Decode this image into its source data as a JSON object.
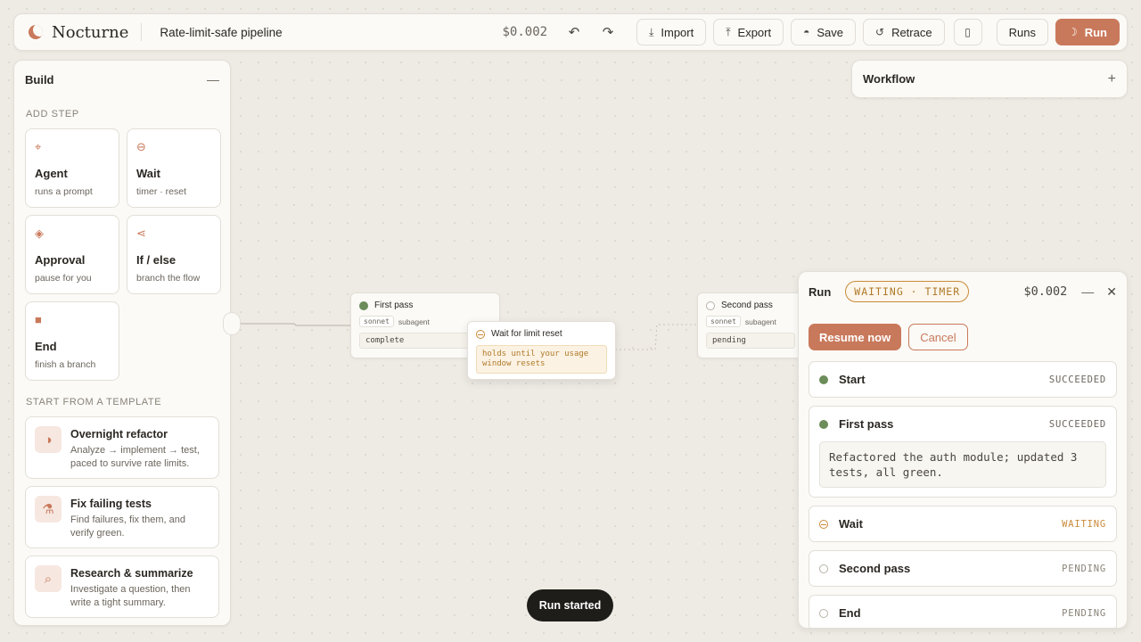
{
  "app": {
    "name": "Nocturne",
    "pipeline_name": "Rate-limit-safe pipeline",
    "cost": "$0.002"
  },
  "toolbar": {
    "undo_icon": "undo-icon",
    "redo_icon": "redo-icon",
    "import_label": "Import",
    "export_label": "Export",
    "save_label": "Save",
    "retrace_label": "Retrace",
    "runs_label": "Runs",
    "run_label": "Run"
  },
  "build": {
    "title": "Build",
    "add_step_label": "ADD STEP",
    "steps": [
      {
        "name": "Agent",
        "desc": "runs a prompt",
        "icon": "agent-icon"
      },
      {
        "name": "Wait",
        "desc": "timer · reset",
        "icon": "wait-icon"
      },
      {
        "name": "Approval",
        "desc": "pause for you",
        "icon": "approval-icon"
      },
      {
        "name": "If / else",
        "desc": "branch the flow",
        "icon": "branch-icon"
      },
      {
        "name": "End",
        "desc": "finish a branch",
        "icon": "end-icon"
      }
    ],
    "templates_label": "START FROM A TEMPLATE",
    "templates": [
      {
        "name": "Overnight refactor",
        "desc": "Analyze → implement → test, paced to survive rate limits."
      },
      {
        "name": "Fix failing tests",
        "desc": "Find failures, fix them, and verify green."
      },
      {
        "name": "Research & summarize",
        "desc": "Investigate a question, then write a tight summary."
      }
    ]
  },
  "workflow": {
    "title": "Workflow"
  },
  "canvas": {
    "nodes": [
      {
        "title": "First pass",
        "model": "sonnet",
        "kind": "subagent",
        "status": "complete"
      },
      {
        "title": "Wait for limit reset",
        "message": "holds until your usage window resets"
      },
      {
        "title": "Second pass",
        "model": "sonnet",
        "kind": "subagent",
        "status": "pending"
      }
    ]
  },
  "run": {
    "title": "Run",
    "badge": "WAITING · TIMER",
    "cost": "$0.002",
    "resume_label": "Resume now",
    "cancel_label": "Cancel",
    "steps": [
      {
        "name": "Start",
        "status": "SUCCEEDED"
      },
      {
        "name": "First pass",
        "status": "SUCCEEDED",
        "output": "Refactored the auth module; updated 3 tests, all green."
      },
      {
        "name": "Wait",
        "status": "WAITING"
      },
      {
        "name": "Second pass",
        "status": "PENDING"
      },
      {
        "name": "End",
        "status": "PENDING"
      }
    ]
  },
  "toast": {
    "message": "Run started"
  },
  "colors": {
    "accent": "#c9795b",
    "success": "#6c8c5a",
    "waiting": "#c98a3a",
    "background": "#eeebe4"
  }
}
